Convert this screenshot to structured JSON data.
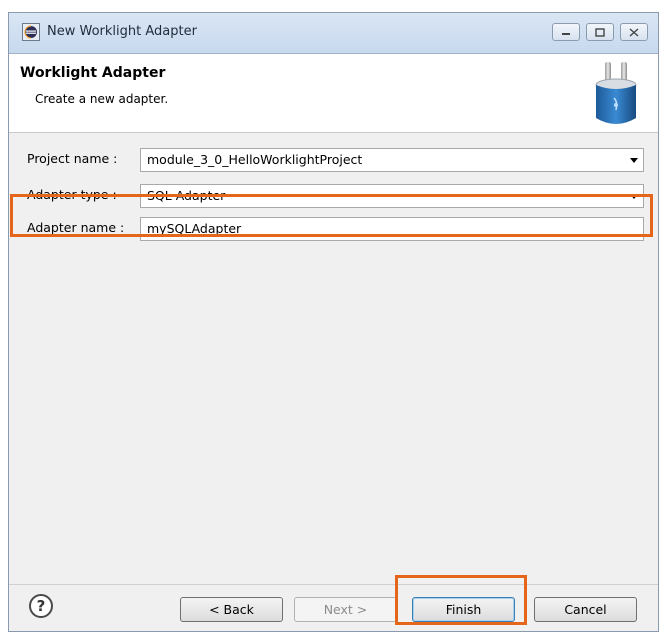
{
  "window": {
    "title": "New Worklight Adapter",
    "icon": "eclipse-icon"
  },
  "header": {
    "title": "Worklight Adapter",
    "description": "Create a new adapter.",
    "graphic": "adapter-plug-icon"
  },
  "form": {
    "project_name": {
      "label": "Project name :",
      "value": "module_3_0_HelloWorklightProject"
    },
    "adapter_type": {
      "label": "Adapter type :",
      "value": "SQL Adapter"
    },
    "adapter_name": {
      "label": "Adapter name :",
      "value": "mySQLAdapter"
    }
  },
  "buttons": {
    "help": "?",
    "back": "< Back",
    "next": "Next >",
    "finish": "Finish",
    "cancel": "Cancel"
  },
  "colors": {
    "highlight": "#e5661a"
  }
}
